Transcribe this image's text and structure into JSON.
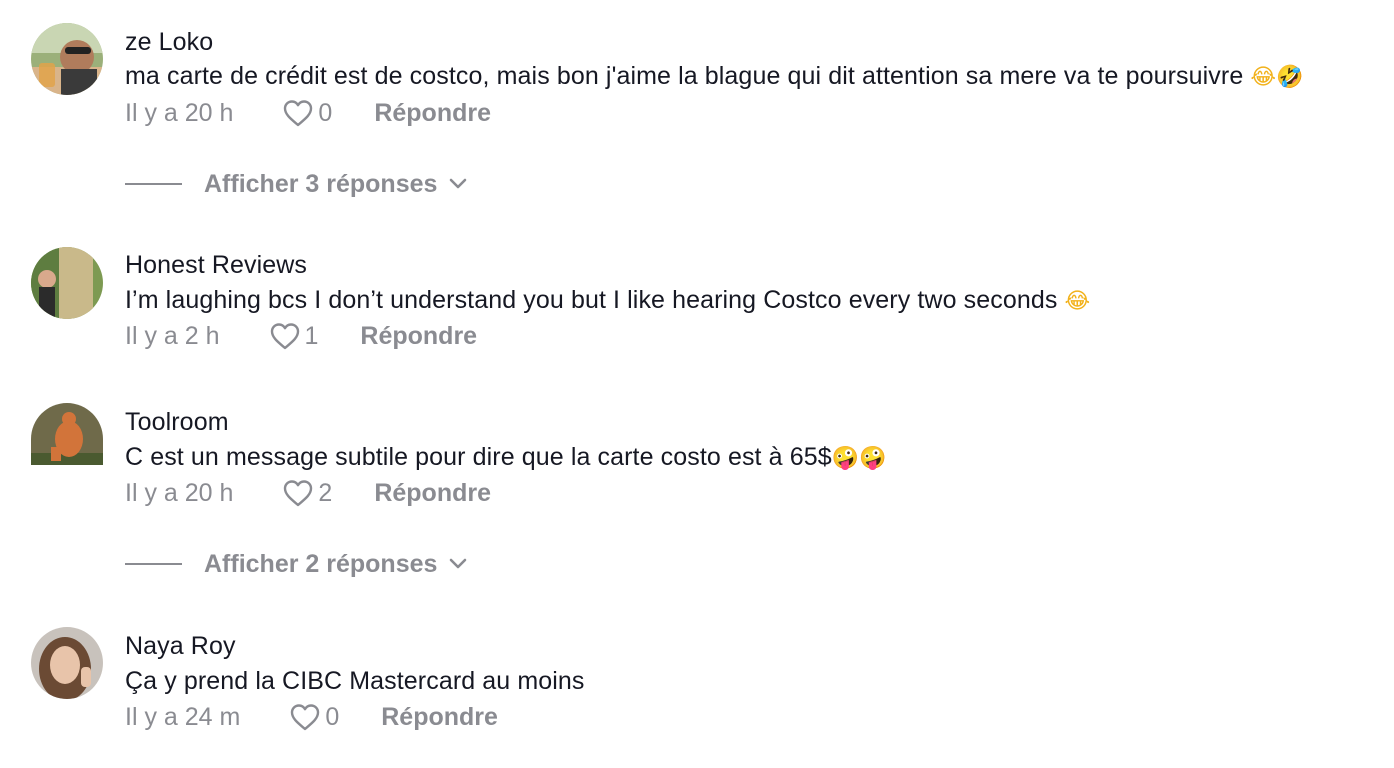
{
  "comments": [
    {
      "author": "ze Loko",
      "text": "ma carte de crédit est de costco, mais bon j'aime la blague qui dit attention sa mere va te poursuivre",
      "emojis": "😂🤣",
      "time": "Il y a 20 h",
      "likes": "0",
      "reply_label": "Répondre",
      "replies_label": "Afficher 3 réponses"
    },
    {
      "author": "Honest Reviews",
      "text": "I’m laughing bcs I don’t understand you but I like hearing Costco every two seconds",
      "emojis": "😂",
      "time": "Il y a 2 h",
      "likes": "1",
      "reply_label": "Répondre"
    },
    {
      "author": "Toolroom",
      "text": "C est un message subtile pour dire que la carte costo est à 65$",
      "emojis": "🤪🤪",
      "time": "Il y a 20 h",
      "likes": "2",
      "reply_label": "Répondre",
      "replies_label": "Afficher 2 réponses"
    },
    {
      "author": "Naya Roy",
      "text": "Ça y prend la CIBC Mastercard au moins",
      "emojis": "",
      "time": "Il y a 24 m",
      "likes": "0",
      "reply_label": "Répondre"
    }
  ],
  "colors": {
    "text_primary": "#161823",
    "text_secondary": "#8a8b91",
    "background": "#ffffff"
  },
  "icons": {
    "like": "heart-outline-icon",
    "expand": "chevron-down-icon"
  }
}
